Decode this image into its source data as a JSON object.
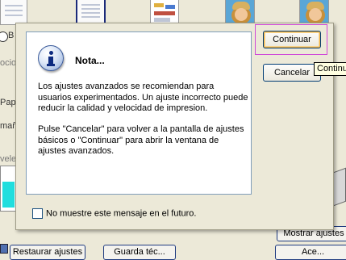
{
  "background": {
    "radio_label_fragment": "B",
    "left_labels": [
      "ocio",
      "Pape",
      "maño",
      "vele"
    ],
    "buttons": {
      "mostrar_ajustes": "Mostrar ajustes",
      "restaurar_ajustes": "Restaurar ajustes",
      "second_bottom": "Guarda téc...",
      "third_bottom": "Ace..."
    }
  },
  "dialog": {
    "title": "Nota...",
    "paragraph1": "Los ajustes avanzados se recomiendan para usuarios experimentados. Un ajuste incorrecto puede reducir la calidad y velocidad de impresion.",
    "paragraph2": "Pulse \"Cancelar\" para volver a la pantalla de ajustes básicos o \"Continuar\" para abrir la ventana de ajustes avanzados.",
    "checkbox_label": "No muestre este mensaje en el futuro.",
    "checkbox_checked": false,
    "continue_label": "Continuar",
    "cancel_label": "Cancelar",
    "tooltip": "Continuar",
    "icon": "info-icon"
  },
  "colors": {
    "dialog_bg": "#ece9d8",
    "button_border": "#003c74",
    "focus_ring": "#d04ad8",
    "tooltip_bg": "#ffffe1"
  }
}
